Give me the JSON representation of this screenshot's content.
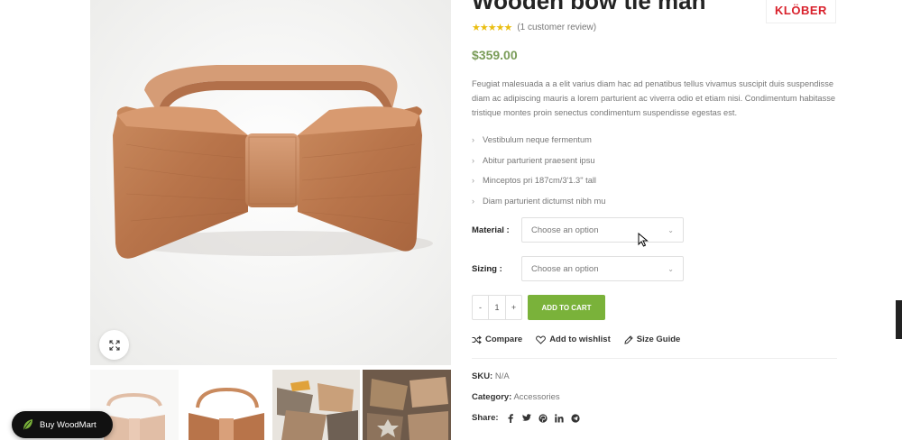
{
  "product": {
    "title": "Wooden bow tie man",
    "brand": "KLÖBER",
    "stars": "★★★★★",
    "review_link": "(1 customer review)",
    "price": "$359.00",
    "description": "Feugiat malesuada a a elit varius diam hac ad penatibus tellus vivamus suscipit duis suspendisse diam ac adipiscing mauris a lorem parturient ac viverra odio et etiam nisi. Condimentum habitasse tristique montes proin senectus condimentum suspendisse egestas est.",
    "features": [
      "Vestibulum neque fermentum",
      "Abitur parturient praesent ipsu",
      "Minceptos pri 187cm/3'1.3\" tall",
      "Diam parturient dictumst nibh mu"
    ]
  },
  "variations": {
    "material_label": "Material :",
    "material_placeholder": "Choose an option",
    "sizing_label": "Sizing :",
    "sizing_placeholder": "Choose an option"
  },
  "cart": {
    "minus": "-",
    "quantity": "1",
    "plus": "+",
    "add_to_cart": "ADD TO CART"
  },
  "actions": {
    "compare": "Compare",
    "wishlist": "Add to wishlist",
    "size_guide": "Size Guide"
  },
  "meta": {
    "sku_label": "SKU:",
    "sku_value": "N/A",
    "category_label": "Category:",
    "category_value": "Accessories",
    "share_label": "Share:"
  },
  "buy_button": "Buy WoodMart",
  "colors": {
    "price": "#7a9c59",
    "add_to_cart": "#7ab23a",
    "stars": "#eabe12",
    "brand": "#d9202b"
  },
  "icons": [
    "expand-icon",
    "compare-icon",
    "heart-icon",
    "pencil-icon",
    "facebook-icon",
    "twitter-icon",
    "pinterest-icon",
    "linkedin-icon",
    "telegram-icon",
    "leaf-icon",
    "chevron-down-icon"
  ]
}
